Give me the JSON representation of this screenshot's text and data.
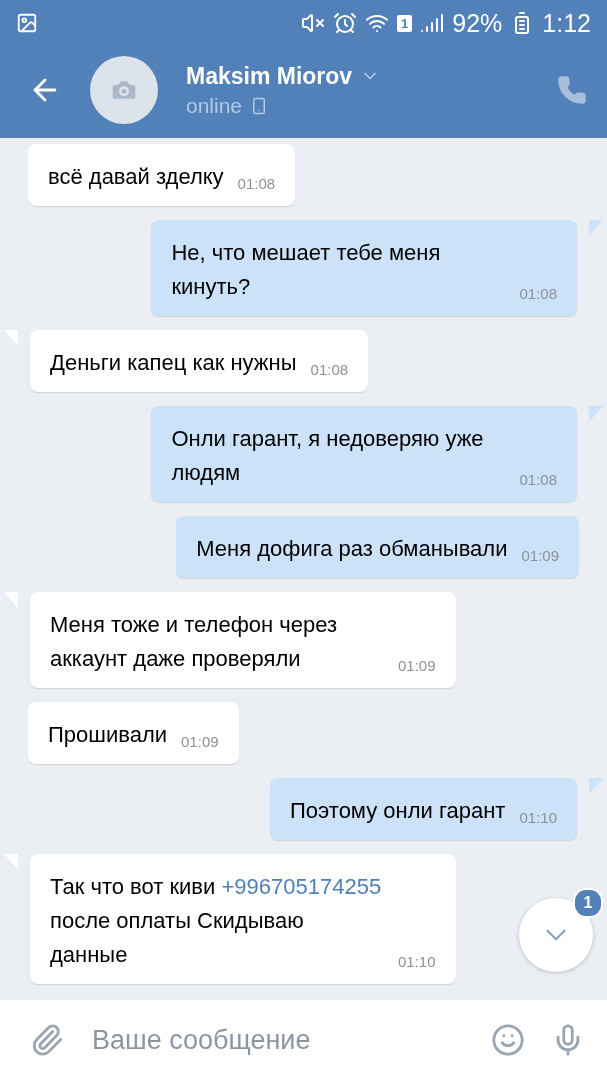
{
  "status_bar": {
    "battery": "92%",
    "time": "1:12",
    "sim": "1"
  },
  "header": {
    "name": "Maksim Miorov",
    "status": "online"
  },
  "messages": [
    {
      "kind": "in",
      "tail": false,
      "parts": [
        {
          "kind": "text",
          "text": "всё давай зделку"
        }
      ],
      "time": "01:08"
    },
    {
      "kind": "out",
      "tail": true,
      "parts": [
        {
          "kind": "text",
          "text": "Не, что мешает тебе меня кинуть?"
        }
      ],
      "time": "01:08"
    },
    {
      "kind": "in",
      "tail": true,
      "parts": [
        {
          "kind": "text",
          "text": "Деньги капец как нужны"
        }
      ],
      "time": "01:08"
    },
    {
      "kind": "out",
      "tail": true,
      "parts": [
        {
          "kind": "text",
          "text": "Онли гарант, я недоверяю уже людям"
        }
      ],
      "time": "01:08"
    },
    {
      "kind": "out",
      "tail": false,
      "parts": [
        {
          "kind": "text",
          "text": "Меня дофига раз обманывали"
        }
      ],
      "time": "01:09"
    },
    {
      "kind": "in",
      "tail": true,
      "parts": [
        {
          "kind": "text",
          "text": "Меня тоже и телефон через аккаунт даже проверяли"
        }
      ],
      "time": "01:09"
    },
    {
      "kind": "in",
      "tail": false,
      "parts": [
        {
          "kind": "text",
          "text": "Прошивали"
        }
      ],
      "time": "01:09"
    },
    {
      "kind": "out",
      "tail": true,
      "parts": [
        {
          "kind": "text",
          "text": "Поэтому онли гарант"
        }
      ],
      "time": "01:10"
    },
    {
      "kind": "in",
      "tail": true,
      "parts": [
        {
          "kind": "text",
          "text": "Так что вот киви "
        },
        {
          "kind": "link",
          "text": "+996705174255"
        },
        {
          "kind": "text",
          "text": " после оплаты Скидываю данные"
        }
      ],
      "time": "01:10"
    }
  ],
  "scroll_button": {
    "badge": "1"
  },
  "composer": {
    "placeholder": "Ваше сообщение"
  }
}
